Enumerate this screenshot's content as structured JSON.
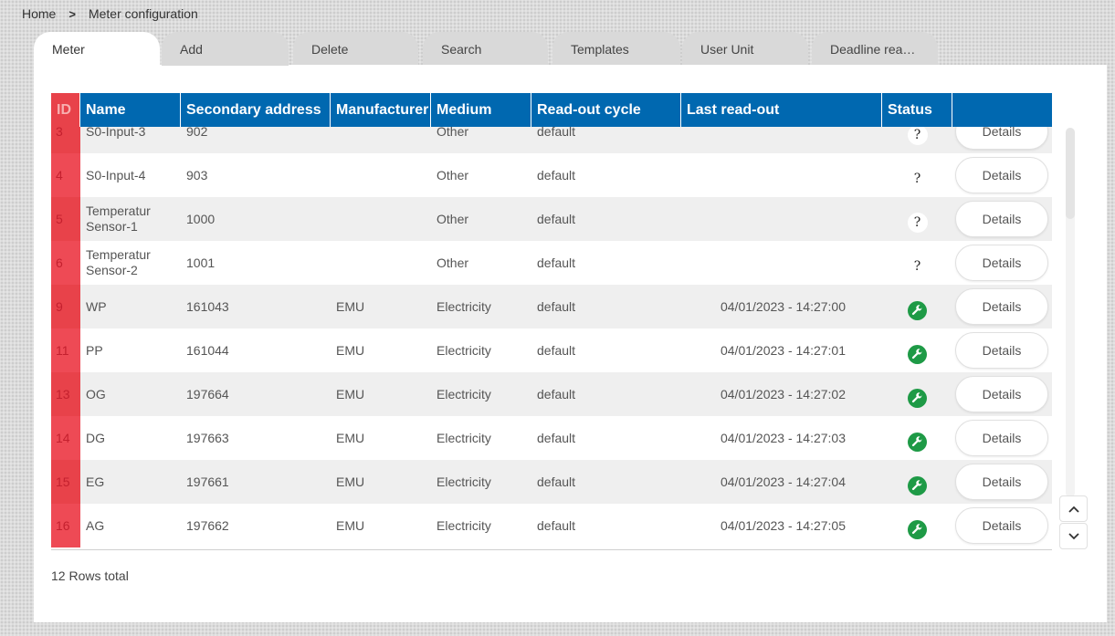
{
  "breadcrumb": {
    "home": "Home",
    "separator": ">",
    "current": "Meter configuration"
  },
  "tabs": [
    "Meter",
    "Add",
    "Delete",
    "Search",
    "Templates",
    "User Unit",
    "Deadline rea…"
  ],
  "table": {
    "columns": [
      "ID",
      "Name",
      "Secondary address",
      "Manufacturer",
      "Medium",
      "Read-out cycle",
      "Last read-out",
      "Status",
      ""
    ],
    "rows": [
      {
        "id": "3",
        "name": "S0-Input-3",
        "address": "902",
        "manufacturer": "",
        "medium": "Other",
        "cycle": "default",
        "last": "",
        "status": "?",
        "status_icon": "question-icon",
        "action": "Details"
      },
      {
        "id": "4",
        "name": "S0-Input-4",
        "address": "903",
        "manufacturer": "",
        "medium": "Other",
        "cycle": "default",
        "last": "",
        "status": "?",
        "status_icon": "question-icon",
        "action": "Details"
      },
      {
        "id": "5",
        "name": "Temperatur Sensor-1",
        "address": "1000",
        "manufacturer": "",
        "medium": "Other",
        "cycle": "default",
        "last": "",
        "status": "?",
        "status_icon": "question-icon",
        "action": "Details"
      },
      {
        "id": "6",
        "name": "Temperatur Sensor-2",
        "address": "1001",
        "manufacturer": "",
        "medium": "Other",
        "cycle": "default",
        "last": "",
        "status": "?",
        "status_icon": "question-icon",
        "action": "Details"
      },
      {
        "id": "9",
        "name": "WP",
        "address": "161043",
        "manufacturer": "EMU",
        "medium": "Electricity",
        "cycle": "default",
        "last": "04/01/2023 - 14:27:00",
        "status": "",
        "status_icon": "wrench-icon",
        "action": "Details"
      },
      {
        "id": "11",
        "name": "PP",
        "address": "161044",
        "manufacturer": "EMU",
        "medium": "Electricity",
        "cycle": "default",
        "last": "04/01/2023 - 14:27:01",
        "status": "",
        "status_icon": "wrench-icon",
        "action": "Details"
      },
      {
        "id": "13",
        "name": "OG",
        "address": "197664",
        "manufacturer": "EMU",
        "medium": "Electricity",
        "cycle": "default",
        "last": "04/01/2023 - 14:27:02",
        "status": "",
        "status_icon": "wrench-icon",
        "action": "Details"
      },
      {
        "id": "14",
        "name": "DG",
        "address": "197663",
        "manufacturer": "EMU",
        "medium": "Electricity",
        "cycle": "default",
        "last": "04/01/2023 - 14:27:03",
        "status": "",
        "status_icon": "wrench-icon",
        "action": "Details"
      },
      {
        "id": "15",
        "name": "EG",
        "address": "197661",
        "manufacturer": "EMU",
        "medium": "Electricity",
        "cycle": "default",
        "last": "04/01/2023 - 14:27:04",
        "status": "",
        "status_icon": "wrench-icon",
        "action": "Details"
      },
      {
        "id": "16",
        "name": "AG",
        "address": "197662",
        "manufacturer": "EMU",
        "medium": "Electricity",
        "cycle": "default",
        "last": "04/01/2023 - 14:27:05",
        "status": "",
        "status_icon": "wrench-icon",
        "action": "Details"
      }
    ]
  },
  "footer": {
    "rows_total": "12 Rows total"
  },
  "colors": {
    "header_bg": "#0068b0",
    "id_column": "#ee4a55",
    "status_ok": "#1e9a46"
  },
  "icons": {
    "scroll_up": "chevron-up-icon",
    "scroll_down": "chevron-down-icon"
  }
}
